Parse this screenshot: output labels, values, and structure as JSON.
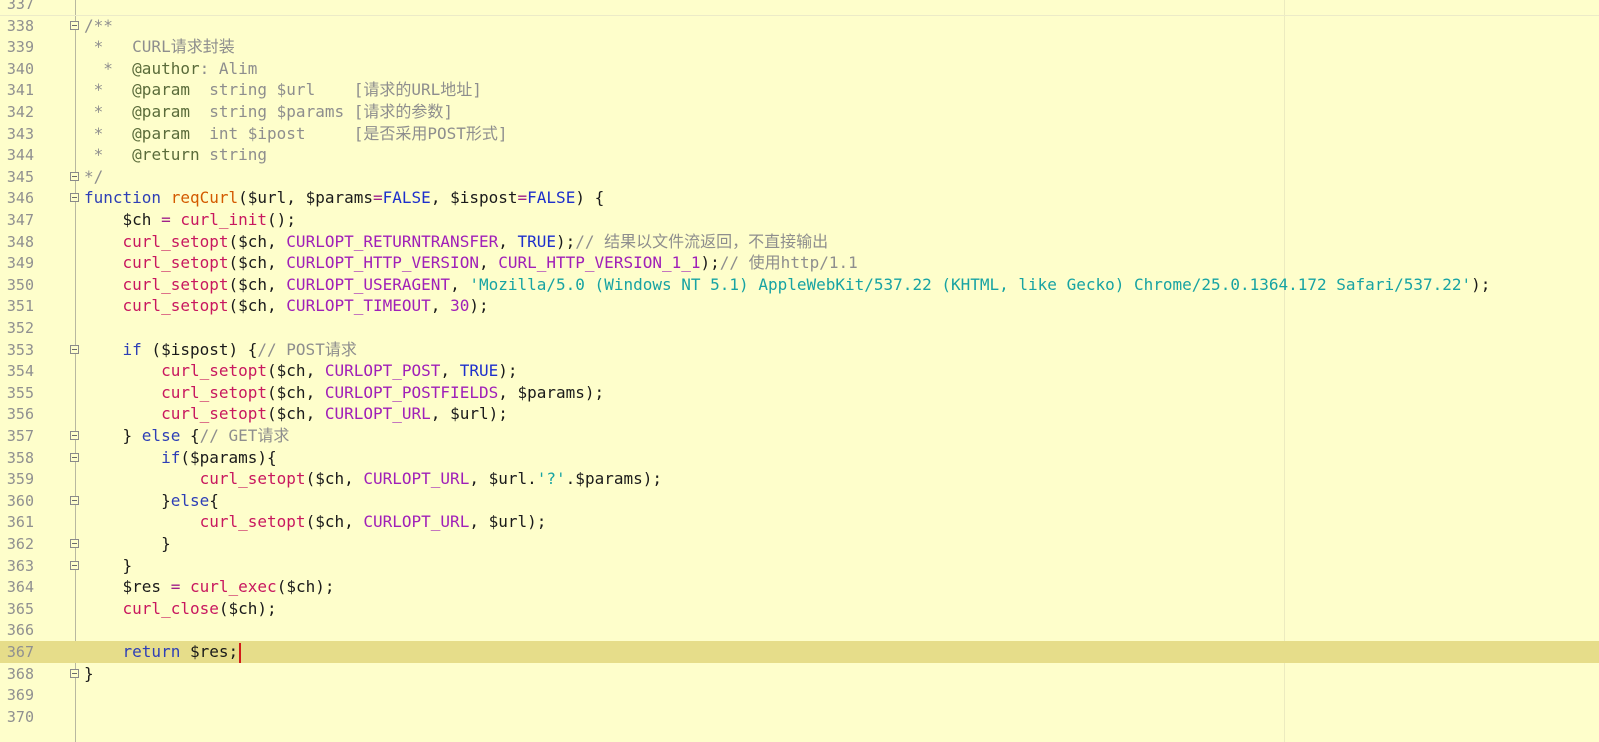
{
  "editor": {
    "current_line": "367",
    "lines": [
      {
        "n": "337",
        "tokens": []
      },
      {
        "n": "338",
        "tokens": [
          {
            "c": "t-cmt",
            "t": "/**"
          }
        ]
      },
      {
        "n": "339",
        "tokens": [
          {
            "c": "t-cmt",
            "t": " *   CURL请求封装"
          }
        ]
      },
      {
        "n": "340",
        "tokens": [
          {
            "c": "t-cmt",
            "t": "  *  "
          },
          {
            "c": "t-tag",
            "t": "@author"
          },
          {
            "c": "t-cmt",
            "t": ": Alim"
          }
        ]
      },
      {
        "n": "341",
        "tokens": [
          {
            "c": "t-cmt",
            "t": " *   "
          },
          {
            "c": "t-tag",
            "t": "@param"
          },
          {
            "c": "t-cmt",
            "t": "  string $url    [请求的URL地址]"
          }
        ]
      },
      {
        "n": "342",
        "tokens": [
          {
            "c": "t-cmt",
            "t": " *   "
          },
          {
            "c": "t-tag",
            "t": "@param"
          },
          {
            "c": "t-cmt",
            "t": "  string $params [请求的参数]"
          }
        ]
      },
      {
        "n": "343",
        "tokens": [
          {
            "c": "t-cmt",
            "t": " *   "
          },
          {
            "c": "t-tag",
            "t": "@param"
          },
          {
            "c": "t-cmt",
            "t": "  int $ipost     [是否采用POST形式]"
          }
        ]
      },
      {
        "n": "344",
        "tokens": [
          {
            "c": "t-cmt",
            "t": " *   "
          },
          {
            "c": "t-tag",
            "t": "@return"
          },
          {
            "c": "t-cmt",
            "t": " string"
          }
        ]
      },
      {
        "n": "345",
        "tokens": [
          {
            "c": "t-cmt",
            "t": "*/"
          }
        ]
      },
      {
        "n": "346",
        "tokens": [
          {
            "c": "t-kw",
            "t": "function"
          },
          {
            "c": "t-var",
            "t": " "
          },
          {
            "c": "t-fn",
            "t": "reqCurl"
          },
          {
            "c": "t-var",
            "t": "($url, $params"
          },
          {
            "c": "t-op",
            "t": "="
          },
          {
            "c": "t-bool",
            "t": "FALSE"
          },
          {
            "c": "t-var",
            "t": ", $ispost"
          },
          {
            "c": "t-op",
            "t": "="
          },
          {
            "c": "t-bool",
            "t": "FALSE"
          },
          {
            "c": "t-var",
            "t": ") {"
          }
        ]
      },
      {
        "n": "347",
        "tokens": [
          {
            "c": "t-var",
            "t": "    $ch "
          },
          {
            "c": "t-op",
            "t": "="
          },
          {
            "c": "t-var",
            "t": " "
          },
          {
            "c": "t-call",
            "t": "curl_init"
          },
          {
            "c": "t-var",
            "t": "();"
          }
        ]
      },
      {
        "n": "348",
        "tokens": [
          {
            "c": "t-var",
            "t": "    "
          },
          {
            "c": "t-call",
            "t": "curl_setopt"
          },
          {
            "c": "t-var",
            "t": "($ch, "
          },
          {
            "c": "t-const",
            "t": "CURLOPT_RETURNTRANSFER"
          },
          {
            "c": "t-var",
            "t": ", "
          },
          {
            "c": "t-bool",
            "t": "TRUE"
          },
          {
            "c": "t-var",
            "t": ");"
          },
          {
            "c": "t-cmt",
            "t": "// 结果以文件流返回，不直接输出"
          }
        ]
      },
      {
        "n": "349",
        "tokens": [
          {
            "c": "t-var",
            "t": "    "
          },
          {
            "c": "t-call",
            "t": "curl_setopt"
          },
          {
            "c": "t-var",
            "t": "($ch, "
          },
          {
            "c": "t-const",
            "t": "CURLOPT_HTTP_VERSION"
          },
          {
            "c": "t-var",
            "t": ", "
          },
          {
            "c": "t-const",
            "t": "CURL_HTTP_VERSION_1_1"
          },
          {
            "c": "t-var",
            "t": ");"
          },
          {
            "c": "t-cmt",
            "t": "// 使用http/1.1"
          }
        ]
      },
      {
        "n": "350",
        "tokens": [
          {
            "c": "t-var",
            "t": "    "
          },
          {
            "c": "t-call",
            "t": "curl_setopt"
          },
          {
            "c": "t-var",
            "t": "($ch, "
          },
          {
            "c": "t-const",
            "t": "CURLOPT_USERAGENT"
          },
          {
            "c": "t-var",
            "t": ", "
          },
          {
            "c": "t-str",
            "t": "'Mozilla/5.0 (Windows NT 5.1) AppleWebKit/537.22 (KHTML, like Gecko) Chrome/25.0.1364.172 Safari/537.22'"
          },
          {
            "c": "t-var",
            "t": ");"
          }
        ]
      },
      {
        "n": "351",
        "tokens": [
          {
            "c": "t-var",
            "t": "    "
          },
          {
            "c": "t-call",
            "t": "curl_setopt"
          },
          {
            "c": "t-var",
            "t": "($ch, "
          },
          {
            "c": "t-const",
            "t": "CURLOPT_TIMEOUT"
          },
          {
            "c": "t-var",
            "t": ", "
          },
          {
            "c": "t-num",
            "t": "30"
          },
          {
            "c": "t-var",
            "t": ");"
          }
        ]
      },
      {
        "n": "352",
        "tokens": []
      },
      {
        "n": "353",
        "tokens": [
          {
            "c": "t-var",
            "t": "    "
          },
          {
            "c": "t-kw",
            "t": "if"
          },
          {
            "c": "t-var",
            "t": " ($ispost) {"
          },
          {
            "c": "t-cmt",
            "t": "// POST请求"
          }
        ]
      },
      {
        "n": "354",
        "tokens": [
          {
            "c": "t-var",
            "t": "        "
          },
          {
            "c": "t-call",
            "t": "curl_setopt"
          },
          {
            "c": "t-var",
            "t": "($ch, "
          },
          {
            "c": "t-const",
            "t": "CURLOPT_POST"
          },
          {
            "c": "t-var",
            "t": ", "
          },
          {
            "c": "t-bool",
            "t": "TRUE"
          },
          {
            "c": "t-var",
            "t": ");"
          }
        ]
      },
      {
        "n": "355",
        "tokens": [
          {
            "c": "t-var",
            "t": "        "
          },
          {
            "c": "t-call",
            "t": "curl_setopt"
          },
          {
            "c": "t-var",
            "t": "($ch, "
          },
          {
            "c": "t-const",
            "t": "CURLOPT_POSTFIELDS"
          },
          {
            "c": "t-var",
            "t": ", $params);"
          }
        ]
      },
      {
        "n": "356",
        "tokens": [
          {
            "c": "t-var",
            "t": "        "
          },
          {
            "c": "t-call",
            "t": "curl_setopt"
          },
          {
            "c": "t-var",
            "t": "($ch, "
          },
          {
            "c": "t-const",
            "t": "CURLOPT_URL"
          },
          {
            "c": "t-var",
            "t": ", $url);"
          }
        ]
      },
      {
        "n": "357",
        "tokens": [
          {
            "c": "t-var",
            "t": "    } "
          },
          {
            "c": "t-kw",
            "t": "else"
          },
          {
            "c": "t-var",
            "t": " {"
          },
          {
            "c": "t-cmt",
            "t": "// GET请求"
          }
        ]
      },
      {
        "n": "358",
        "tokens": [
          {
            "c": "t-var",
            "t": "        "
          },
          {
            "c": "t-kw",
            "t": "if"
          },
          {
            "c": "t-var",
            "t": "($params){"
          }
        ]
      },
      {
        "n": "359",
        "tokens": [
          {
            "c": "t-var",
            "t": "            "
          },
          {
            "c": "t-call",
            "t": "curl_setopt"
          },
          {
            "c": "t-var",
            "t": "($ch, "
          },
          {
            "c": "t-const",
            "t": "CURLOPT_URL"
          },
          {
            "c": "t-var",
            "t": ", $url."
          },
          {
            "c": "t-str",
            "t": "'?'"
          },
          {
            "c": "t-var",
            "t": ".$params);"
          }
        ]
      },
      {
        "n": "360",
        "tokens": [
          {
            "c": "t-var",
            "t": "        }"
          },
          {
            "c": "t-kw",
            "t": "else"
          },
          {
            "c": "t-var",
            "t": "{"
          }
        ]
      },
      {
        "n": "361",
        "tokens": [
          {
            "c": "t-var",
            "t": "            "
          },
          {
            "c": "t-call",
            "t": "curl_setopt"
          },
          {
            "c": "t-var",
            "t": "($ch, "
          },
          {
            "c": "t-const",
            "t": "CURLOPT_URL"
          },
          {
            "c": "t-var",
            "t": ", $url);"
          }
        ]
      },
      {
        "n": "362",
        "tokens": [
          {
            "c": "t-var",
            "t": "        }"
          }
        ]
      },
      {
        "n": "363",
        "tokens": [
          {
            "c": "t-var",
            "t": "    }"
          }
        ]
      },
      {
        "n": "364",
        "tokens": [
          {
            "c": "t-var",
            "t": "    $res "
          },
          {
            "c": "t-op",
            "t": "="
          },
          {
            "c": "t-var",
            "t": " "
          },
          {
            "c": "t-call",
            "t": "curl_exec"
          },
          {
            "c": "t-var",
            "t": "($ch);"
          }
        ]
      },
      {
        "n": "365",
        "tokens": [
          {
            "c": "t-var",
            "t": "    "
          },
          {
            "c": "t-call",
            "t": "curl_close"
          },
          {
            "c": "t-var",
            "t": "($ch);"
          }
        ]
      },
      {
        "n": "366",
        "tokens": []
      },
      {
        "n": "367",
        "tokens": [
          {
            "c": "t-var",
            "t": "    "
          },
          {
            "c": "t-kw",
            "t": "return"
          },
          {
            "c": "t-var",
            "t": " $res;"
          }
        ]
      },
      {
        "n": "368",
        "tokens": [
          {
            "c": "t-var",
            "t": "}"
          }
        ]
      },
      {
        "n": "369",
        "tokens": []
      },
      {
        "n": "370",
        "tokens": []
      }
    ],
    "fold_markers": [
      "338",
      "345",
      "346",
      "353",
      "357",
      "358",
      "360",
      "362",
      "363",
      "368"
    ]
  }
}
